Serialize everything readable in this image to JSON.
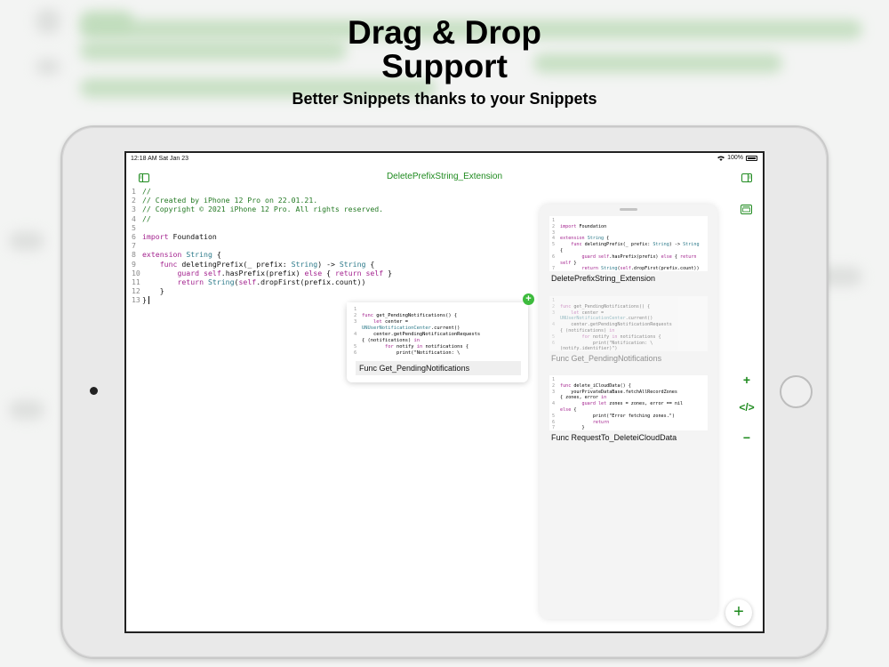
{
  "hero": {
    "title_line1": "Drag & Drop",
    "title_line2": "Support",
    "subtitle": "Better Snippets thanks to your Snippets"
  },
  "status_bar": {
    "time": "12:18 AM  Sat Jan 23",
    "battery": "100%"
  },
  "nav": {
    "title": "DeletePrefixString_Extension",
    "sidebar_icon": "sidebar-left-icon",
    "right_icon": "sidebar-right-icon",
    "library_icon": "snippet-library-icon"
  },
  "editor": {
    "lines": [
      {
        "n": "1",
        "t": "//"
      },
      {
        "n": "2",
        "t": "// Created by iPhone 12 Pro on 22.01.21."
      },
      {
        "n": "3",
        "t": "// Copyright © 2021 iPhone 12 Pro. All rights reserved."
      },
      {
        "n": "4",
        "t": "//"
      },
      {
        "n": "5",
        "t": ""
      },
      {
        "n": "6",
        "t": "import Foundation"
      },
      {
        "n": "7",
        "t": ""
      },
      {
        "n": "8",
        "t": "extension String {"
      },
      {
        "n": "9",
        "t": "    func deletingPrefix(_ prefix: String) -> String {"
      },
      {
        "n": "10",
        "t": "        guard self.hasPrefix(prefix) else { return self }"
      },
      {
        "n": "11",
        "t": "        return String(self.dropFirst(prefix.count))"
      },
      {
        "n": "12",
        "t": "    }"
      },
      {
        "n": "13",
        "t": "}"
      }
    ]
  },
  "snippets": [
    {
      "label": "DeletePrefixString_Extension",
      "code": [
        {
          "n": "1",
          "t": ""
        },
        {
          "n": "2",
          "t": "import Foundation"
        },
        {
          "n": "3",
          "t": ""
        },
        {
          "n": "4",
          "t": "extension String {"
        },
        {
          "n": "5",
          "t": "    func deletingPrefix(_ prefix: String) -> String"
        },
        {
          "n": "",
          "t": "{"
        },
        {
          "n": "6",
          "t": "        guard self.hasPrefix(prefix) else { return"
        },
        {
          "n": "",
          "t": "self }"
        },
        {
          "n": "7",
          "t": "        return String(self.dropFirst(prefix.count))"
        }
      ]
    },
    {
      "label": "Func Get_PendingNotifications",
      "code": [
        {
          "n": "1",
          "t": ""
        },
        {
          "n": "2",
          "t": "func get_PendingNotifications() {"
        },
        {
          "n": "3",
          "t": "    let center ="
        },
        {
          "n": "",
          "t": "UNUserNotificationCenter.current()"
        },
        {
          "n": "4",
          "t": "    center.getPendingNotificationRequests"
        },
        {
          "n": "",
          "t": "{ (notifications) in"
        },
        {
          "n": "5",
          "t": "        for notify in notifications {"
        },
        {
          "n": "6",
          "t": "            print(\"Notification: \\"
        },
        {
          "n": "",
          "t": "(notify.identifier)\")"
        }
      ]
    },
    {
      "label": "Func RequestTo_DeleteiCloudData",
      "code": [
        {
          "n": "1",
          "t": ""
        },
        {
          "n": "2",
          "t": "func delete_iCloudData() {"
        },
        {
          "n": "3",
          "t": "    yourPrivateDataBase.fetchAllRecordZones"
        },
        {
          "n": "",
          "t": "{ zones, error in"
        },
        {
          "n": "4",
          "t": "        guard let zones = zones, error == nil"
        },
        {
          "n": "",
          "t": "else {"
        },
        {
          "n": "5",
          "t": "            print(\"Error fetching zones.\")"
        },
        {
          "n": "6",
          "t": "            return"
        },
        {
          "n": "7",
          "t": "        }"
        }
      ]
    }
  ],
  "drag_card": {
    "label": "Func Get_PendingNotifications",
    "badge": "+",
    "code": [
      {
        "n": "1",
        "t": ""
      },
      {
        "n": "2",
        "t": "func get_PendingNotifications() {"
      },
      {
        "n": "3",
        "t": "    let center ="
      },
      {
        "n": "",
        "t": "UNUserNotificationCenter.current()"
      },
      {
        "n": "4",
        "t": "    center.getPendingNotificationRequests"
      },
      {
        "n": "",
        "t": "{ (notifications) in"
      },
      {
        "n": "5",
        "t": "        for notify in notifications {"
      },
      {
        "n": "6",
        "t": "            print(\"Notification: \\"
      },
      {
        "n": "",
        "t": "(notify.identifier)\")"
      }
    ]
  },
  "tools": {
    "zoom_in": "+",
    "code": "</>",
    "zoom_out": "−",
    "add": "+"
  },
  "colors": {
    "accent": "#1e8a1e",
    "comment": "#257a25",
    "keyword": "#a4248f",
    "type": "#2c7a8a",
    "badge": "#3dbb3d"
  }
}
